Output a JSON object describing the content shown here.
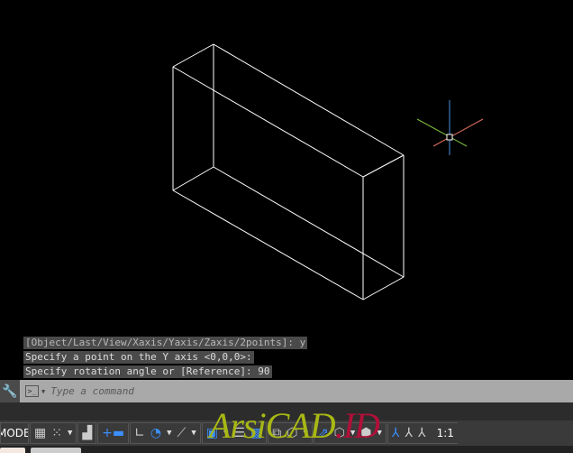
{
  "history": [
    "[Object/Last/View/Xaxis/Yaxis/Zaxis/2points]: y",
    "Specify a point on the Y axis <0,0,0>:",
    "Specify rotation angle or [Reference]: 90"
  ],
  "command": {
    "placeholder": "Type a command",
    "icon": "command-prompt-icon",
    "settings_icon": "wrench-icon"
  },
  "status": {
    "model_label": "MODEL",
    "scale_label": "1:1"
  },
  "watermark": {
    "part1": "ArsiCAD",
    "part2": ".ID"
  },
  "colors": {
    "background": "#000000",
    "wireframe": "#ffffff",
    "x_axis": "#e07060",
    "y_axis": "#80c040",
    "z_axis": "#4a90e0",
    "accent": "#3b8fff"
  }
}
